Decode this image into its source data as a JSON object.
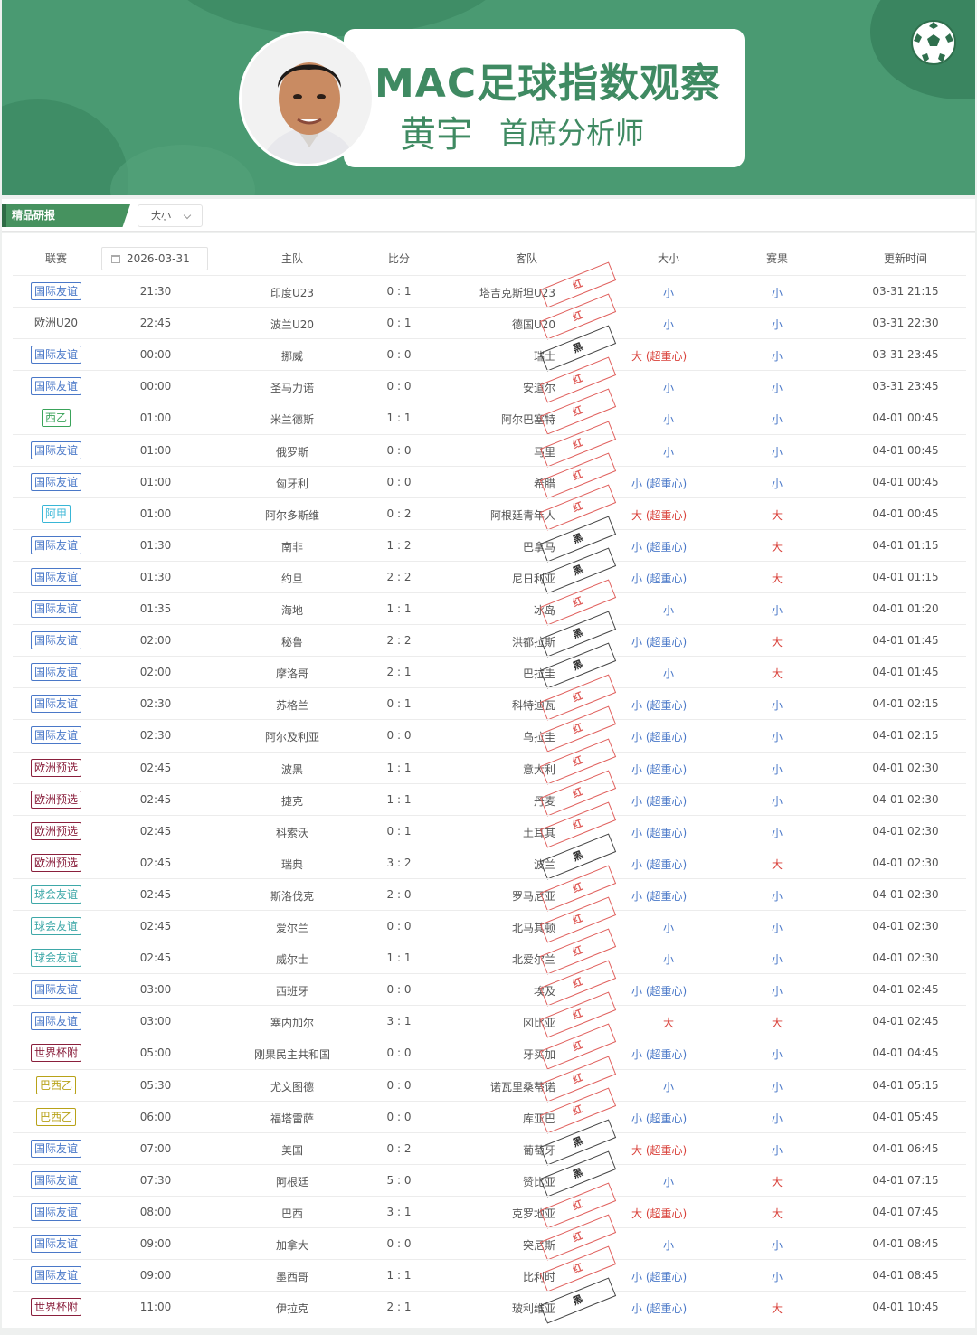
{
  "banner": {
    "title": "MAC足球指数观察",
    "name": "黄宇",
    "role": "首席分析师"
  },
  "filter": {
    "section_label": "精品研报",
    "select_value": "大小"
  },
  "table": {
    "headers": [
      "联赛",
      "2026-03-31",
      "主队",
      "比分",
      "客队",
      "大小",
      "赛果",
      "更新时间"
    ],
    "date": "2026-03-31",
    "rows": [
      {
        "league": "国际友谊",
        "tag": "blue",
        "time": "21:30",
        "home": "印度U23",
        "score": "0 : 1",
        "away": "塔吉克斯坦U23",
        "stamp": "红",
        "stamp_color": "red",
        "ou": "小",
        "ou_type": "small",
        "result": "小",
        "upd": "03-31 21:15"
      },
      {
        "league": "欧洲U20",
        "tag": "plain",
        "time": "22:45",
        "home": "波兰U20",
        "score": "0 : 1",
        "away": "德国U20",
        "stamp": "红",
        "stamp_color": "red",
        "ou": "小",
        "ou_type": "small",
        "result": "小",
        "upd": "03-31 22:30"
      },
      {
        "league": "国际友谊",
        "tag": "blue",
        "time": "00:00",
        "home": "挪威",
        "score": "0 : 0",
        "away": "瑞士",
        "stamp": "黑",
        "stamp_color": "black",
        "ou": "大 (超重心)",
        "ou_type": "big",
        "result": "小",
        "upd": "03-31 23:45"
      },
      {
        "league": "国际友谊",
        "tag": "blue",
        "time": "00:00",
        "home": "圣马力诺",
        "score": "0 : 0",
        "away": "安道尔",
        "stamp": "红",
        "stamp_color": "red",
        "ou": "小",
        "ou_type": "small",
        "result": "小",
        "upd": "03-31 23:45"
      },
      {
        "league": "西乙",
        "tag": "green",
        "time": "01:00",
        "home": "米兰德斯",
        "score": "1 : 1",
        "away": "阿尔巴塞特",
        "stamp": "红",
        "stamp_color": "red",
        "ou": "小",
        "ou_type": "small",
        "result": "小",
        "upd": "04-01 00:45"
      },
      {
        "league": "国际友谊",
        "tag": "blue",
        "time": "01:00",
        "home": "俄罗斯",
        "score": "0 : 0",
        "away": "马里",
        "stamp": "红",
        "stamp_color": "red",
        "ou": "小",
        "ou_type": "small",
        "result": "小",
        "upd": "04-01 00:45"
      },
      {
        "league": "国际友谊",
        "tag": "blue",
        "time": "01:00",
        "home": "匈牙利",
        "score": "0 : 0",
        "away": "希腊",
        "stamp": "红",
        "stamp_color": "red",
        "ou": "小 (超重心)",
        "ou_type": "small",
        "result": "小",
        "upd": "04-01 00:45"
      },
      {
        "league": "阿甲",
        "tag": "cyan",
        "time": "01:00",
        "home": "阿尔多斯维",
        "score": "0 : 2",
        "away": "阿根廷青年人",
        "stamp": "红",
        "stamp_color": "red",
        "ou": "大 (超重心)",
        "ou_type": "big",
        "result": "大",
        "upd": "04-01 00:45"
      },
      {
        "league": "国际友谊",
        "tag": "blue",
        "time": "01:30",
        "home": "南非",
        "score": "1 : 2",
        "away": "巴拿马",
        "stamp": "黑",
        "stamp_color": "black",
        "ou": "小 (超重心)",
        "ou_type": "small",
        "result": "大",
        "upd": "04-01 01:15"
      },
      {
        "league": "国际友谊",
        "tag": "blue",
        "time": "01:30",
        "home": "约旦",
        "score": "2 : 2",
        "away": "尼日利亚",
        "stamp": "黑",
        "stamp_color": "black",
        "ou": "小 (超重心)",
        "ou_type": "small",
        "result": "大",
        "upd": "04-01 01:15"
      },
      {
        "league": "国际友谊",
        "tag": "blue",
        "time": "01:35",
        "home": "海地",
        "score": "1 : 1",
        "away": "冰岛",
        "stamp": "红",
        "stamp_color": "red",
        "ou": "小",
        "ou_type": "small",
        "result": "小",
        "upd": "04-01 01:20"
      },
      {
        "league": "国际友谊",
        "tag": "blue",
        "time": "02:00",
        "home": "秘鲁",
        "score": "2 : 2",
        "away": "洪都拉斯",
        "stamp": "黑",
        "stamp_color": "black",
        "ou": "小 (超重心)",
        "ou_type": "small",
        "result": "大",
        "upd": "04-01 01:45"
      },
      {
        "league": "国际友谊",
        "tag": "blue",
        "time": "02:00",
        "home": "摩洛哥",
        "score": "2 : 1",
        "away": "巴拉圭",
        "stamp": "黑",
        "stamp_color": "black",
        "ou": "小",
        "ou_type": "small",
        "result": "大",
        "upd": "04-01 01:45"
      },
      {
        "league": "国际友谊",
        "tag": "blue",
        "time": "02:30",
        "home": "苏格兰",
        "score": "0 : 1",
        "away": "科特迪瓦",
        "stamp": "红",
        "stamp_color": "red",
        "ou": "小 (超重心)",
        "ou_type": "small",
        "result": "小",
        "upd": "04-01 02:15"
      },
      {
        "league": "国际友谊",
        "tag": "blue",
        "time": "02:30",
        "home": "阿尔及利亚",
        "score": "0 : 0",
        "away": "乌拉圭",
        "stamp": "红",
        "stamp_color": "red",
        "ou": "小 (超重心)",
        "ou_type": "small",
        "result": "小",
        "upd": "04-01 02:15"
      },
      {
        "league": "欧洲预选",
        "tag": "maroon",
        "time": "02:45",
        "home": "波黑",
        "score": "1 : 1",
        "away": "意大利",
        "stamp": "红",
        "stamp_color": "red",
        "ou": "小 (超重心)",
        "ou_type": "small",
        "result": "小",
        "upd": "04-01 02:30"
      },
      {
        "league": "欧洲预选",
        "tag": "maroon",
        "time": "02:45",
        "home": "捷克",
        "score": "1 : 1",
        "away": "丹麦",
        "stamp": "红",
        "stamp_color": "red",
        "ou": "小 (超重心)",
        "ou_type": "small",
        "result": "小",
        "upd": "04-01 02:30"
      },
      {
        "league": "欧洲预选",
        "tag": "maroon",
        "time": "02:45",
        "home": "科索沃",
        "score": "0 : 1",
        "away": "土耳其",
        "stamp": "红",
        "stamp_color": "red",
        "ou": "小 (超重心)",
        "ou_type": "small",
        "result": "小",
        "upd": "04-01 02:30"
      },
      {
        "league": "欧洲预选",
        "tag": "maroon",
        "time": "02:45",
        "home": "瑞典",
        "score": "3 : 2",
        "away": "波兰",
        "stamp": "黑",
        "stamp_color": "black",
        "ou": "小 (超重心)",
        "ou_type": "small",
        "result": "大",
        "upd": "04-01 02:30"
      },
      {
        "league": "球会友谊",
        "tag": "teal",
        "time": "02:45",
        "home": "斯洛伐克",
        "score": "2 : 0",
        "away": "罗马尼亚",
        "stamp": "红",
        "stamp_color": "red",
        "ou": "小 (超重心)",
        "ou_type": "small",
        "result": "小",
        "upd": "04-01 02:30"
      },
      {
        "league": "球会友谊",
        "tag": "teal",
        "time": "02:45",
        "home": "爱尔兰",
        "score": "0 : 0",
        "away": "北马其顿",
        "stamp": "红",
        "stamp_color": "red",
        "ou": "小",
        "ou_type": "small",
        "result": "小",
        "upd": "04-01 02:30"
      },
      {
        "league": "球会友谊",
        "tag": "teal",
        "time": "02:45",
        "home": "威尔士",
        "score": "1 : 1",
        "away": "北爱尔兰",
        "stamp": "红",
        "stamp_color": "red",
        "ou": "小",
        "ou_type": "small",
        "result": "小",
        "upd": "04-01 02:30"
      },
      {
        "league": "国际友谊",
        "tag": "blue",
        "time": "03:00",
        "home": "西班牙",
        "score": "0 : 0",
        "away": "埃及",
        "stamp": "红",
        "stamp_color": "red",
        "ou": "小 (超重心)",
        "ou_type": "small",
        "result": "小",
        "upd": "04-01 02:45"
      },
      {
        "league": "国际友谊",
        "tag": "blue",
        "time": "03:00",
        "home": "塞内加尔",
        "score": "3 : 1",
        "away": "冈比亚",
        "stamp": "红",
        "stamp_color": "red",
        "ou": "大",
        "ou_type": "big",
        "result": "大",
        "upd": "04-01 02:45"
      },
      {
        "league": "世界杯附",
        "tag": "maroon",
        "time": "05:00",
        "home": "刚果民主共和国",
        "score": "0 : 0",
        "away": "牙买加",
        "stamp": "红",
        "stamp_color": "red",
        "ou": "小 (超重心)",
        "ou_type": "small",
        "result": "小",
        "upd": "04-01 04:45"
      },
      {
        "league": "巴西乙",
        "tag": "yellow",
        "time": "05:30",
        "home": "尤文图德",
        "score": "0 : 0",
        "away": "诺瓦里桑蒂诺",
        "stamp": "红",
        "stamp_color": "red",
        "ou": "小",
        "ou_type": "small",
        "result": "小",
        "upd": "04-01 05:15"
      },
      {
        "league": "巴西乙",
        "tag": "yellow",
        "time": "06:00",
        "home": "福塔雷萨",
        "score": "0 : 0",
        "away": "库亚巴",
        "stamp": "红",
        "stamp_color": "red",
        "ou": "小 (超重心)",
        "ou_type": "small",
        "result": "小",
        "upd": "04-01 05:45"
      },
      {
        "league": "国际友谊",
        "tag": "blue",
        "time": "07:00",
        "home": "美国",
        "score": "0 : 2",
        "away": "葡萄牙",
        "stamp": "黑",
        "stamp_color": "black",
        "ou": "大 (超重心)",
        "ou_type": "big",
        "result": "小",
        "upd": "04-01 06:45"
      },
      {
        "league": "国际友谊",
        "tag": "blue",
        "time": "07:30",
        "home": "阿根廷",
        "score": "5 : 0",
        "away": "赞比亚",
        "stamp": "黑",
        "stamp_color": "black",
        "ou": "小",
        "ou_type": "small",
        "result": "大",
        "upd": "04-01 07:15"
      },
      {
        "league": "国际友谊",
        "tag": "blue",
        "time": "08:00",
        "home": "巴西",
        "score": "3 : 1",
        "away": "克罗地亚",
        "stamp": "红",
        "stamp_color": "red",
        "ou": "大 (超重心)",
        "ou_type": "big",
        "result": "大",
        "upd": "04-01 07:45"
      },
      {
        "league": "国际友谊",
        "tag": "blue",
        "time": "09:00",
        "home": "加拿大",
        "score": "0 : 0",
        "away": "突尼斯",
        "stamp": "红",
        "stamp_color": "red",
        "ou": "小",
        "ou_type": "small",
        "result": "小",
        "upd": "04-01 08:45"
      },
      {
        "league": "国际友谊",
        "tag": "blue",
        "time": "09:00",
        "home": "墨西哥",
        "score": "1 : 1",
        "away": "比利时",
        "stamp": "红",
        "stamp_color": "red",
        "ou": "小 (超重心)",
        "ou_type": "small",
        "result": "小",
        "upd": "04-01 08:45"
      },
      {
        "league": "世界杯附",
        "tag": "maroon",
        "time": "11:00",
        "home": "伊拉克",
        "score": "2 : 1",
        "away": "玻利维亚",
        "stamp": "黑",
        "stamp_color": "black",
        "ou": "小 (超重心)",
        "ou_type": "small",
        "result": "大",
        "upd": "04-01 10:45"
      }
    ]
  },
  "tag_colors": {
    "blue": "#4a78c8",
    "green": "#3aa35a",
    "cyan": "#38b6d6",
    "maroon": "#8a1f3c",
    "teal": "#3ea8a8",
    "yellow": "#b8a218",
    "plain": "#555555"
  },
  "icons": {
    "ball": "soccer-ball-icon",
    "calendar": "calendar-icon",
    "chevron": "chevron-down-icon"
  }
}
